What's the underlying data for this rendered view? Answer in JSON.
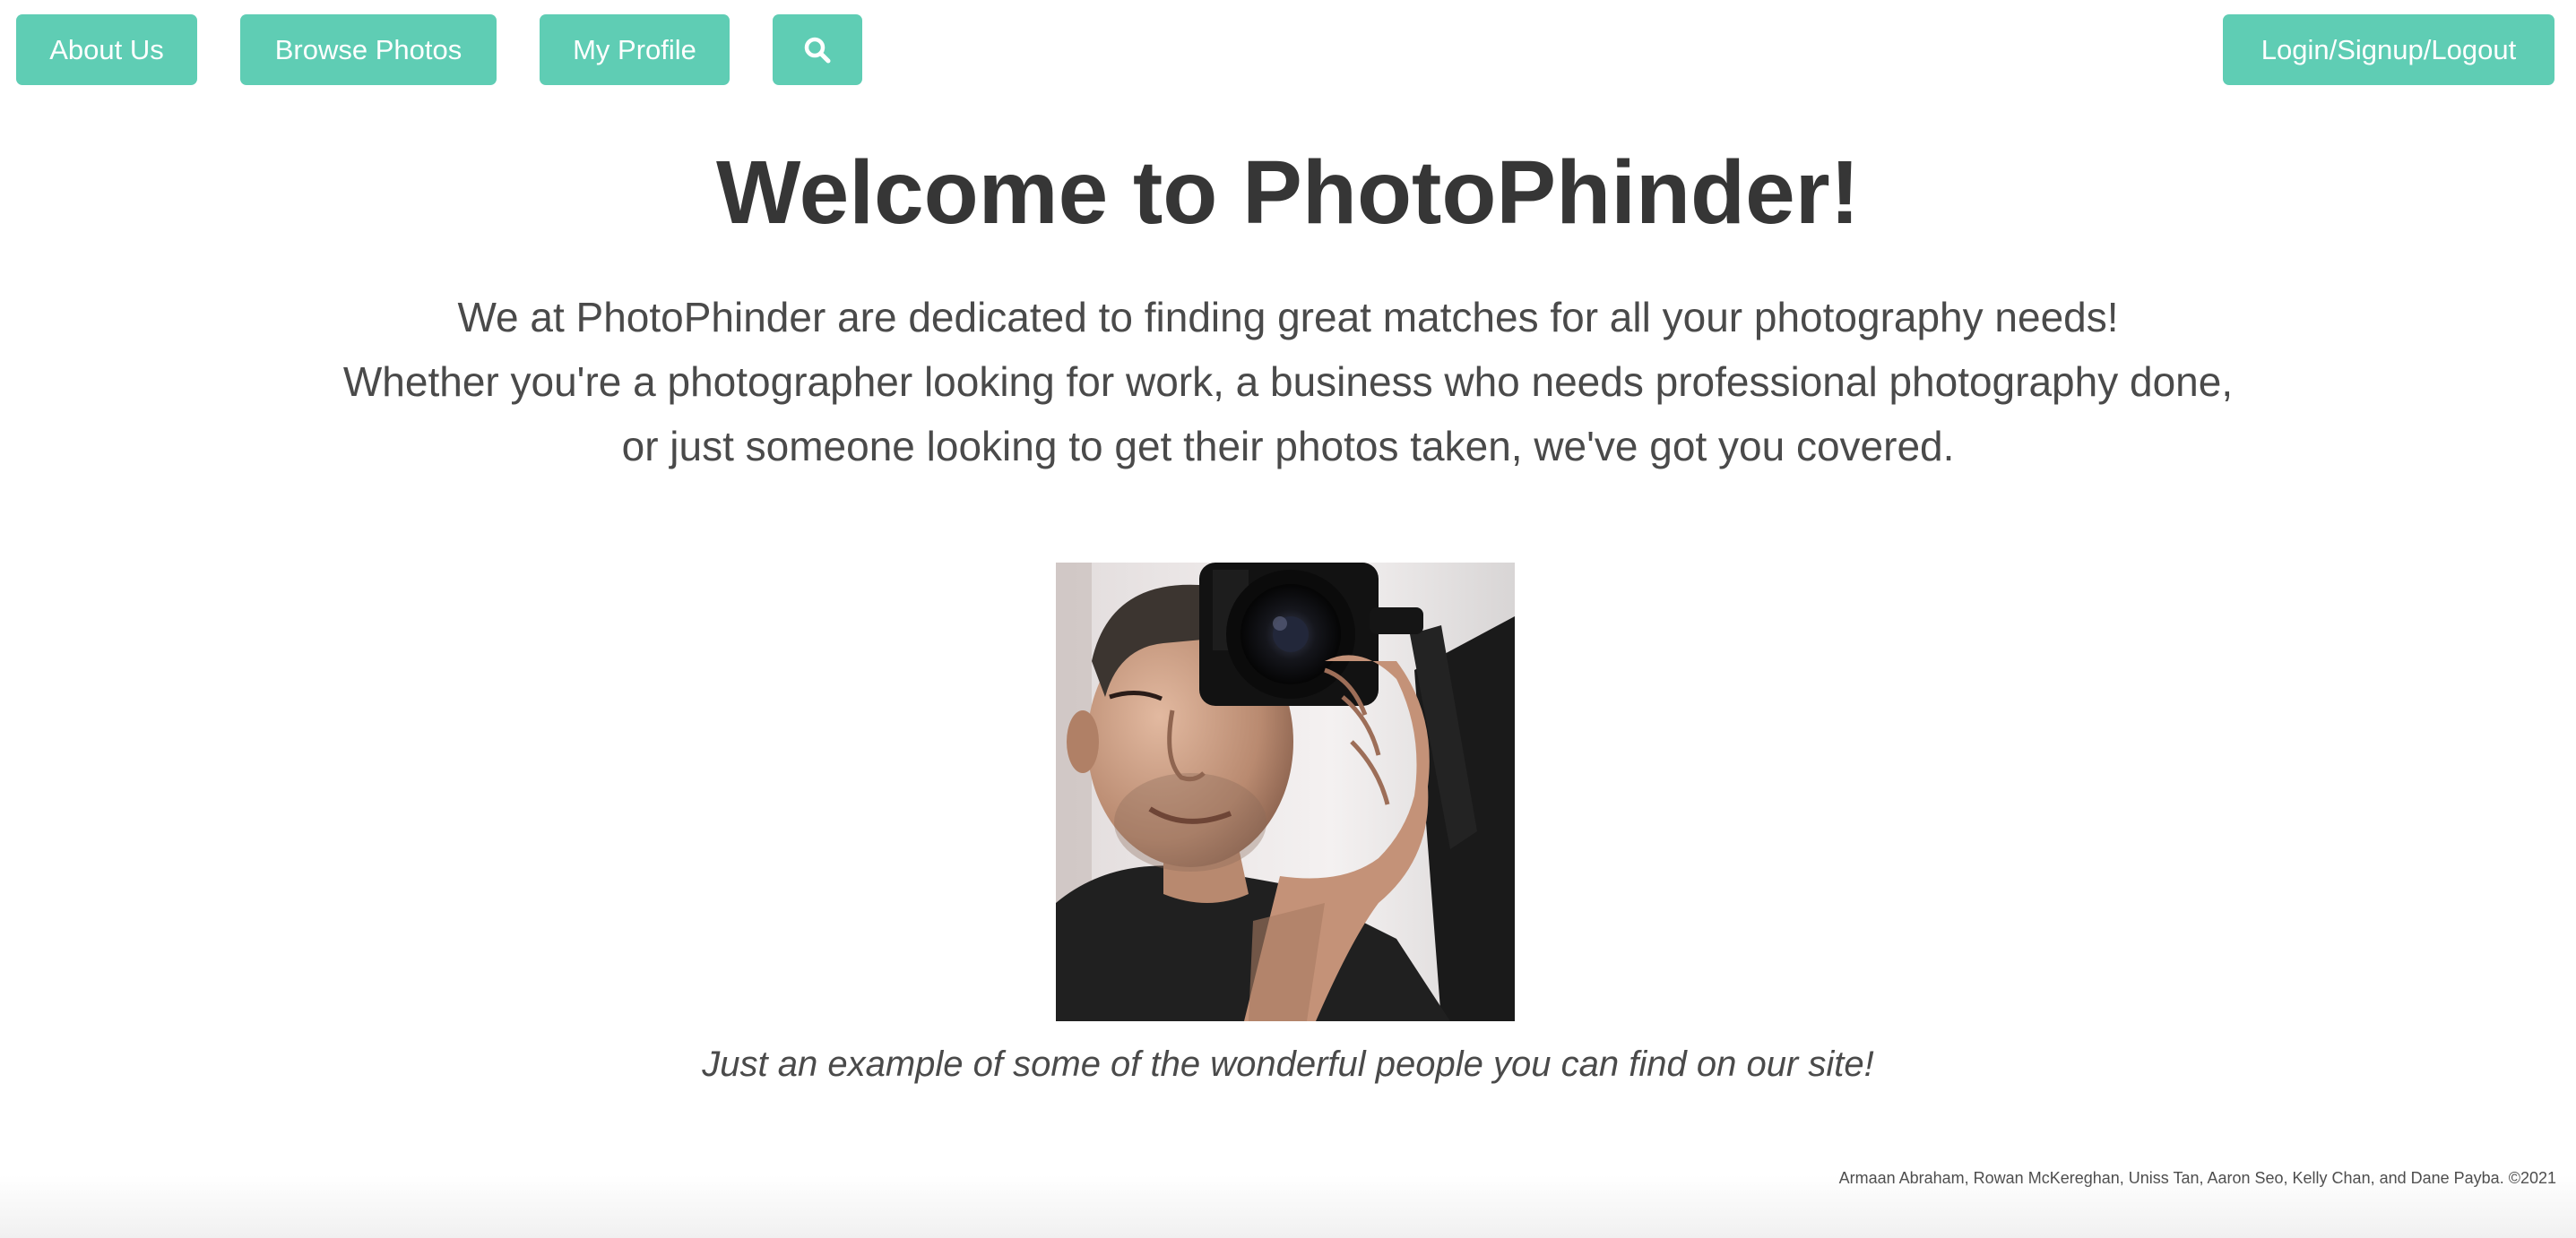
{
  "nav": {
    "about_label": "About Us",
    "browse_label": "Browse Photos",
    "profile_label": "My Profile",
    "search_icon": "search-icon",
    "login_label": "Login/Signup/Logout"
  },
  "main": {
    "title": "Welcome to PhotoPhinder!",
    "intro_lines": [
      "We at PhotoPhinder are dedicated to finding great matches for all your photography needs!",
      "Whether you're a photographer looking for work, a business who needs professional photography done,",
      "or just someone looking to get their photos taken, we've got you covered."
    ],
    "caption": "Just an example of some of the wonderful people you can find on our site!"
  },
  "footer": {
    "credits": "Armaan Abraham, Rowan McKereghan, Uniss Tan, Aaron Seo, Kelly Chan, and Dane Payba. ©2021"
  },
  "colors": {
    "accent": "#5fcdb4",
    "text": "#363636",
    "background": "#ffffff"
  }
}
